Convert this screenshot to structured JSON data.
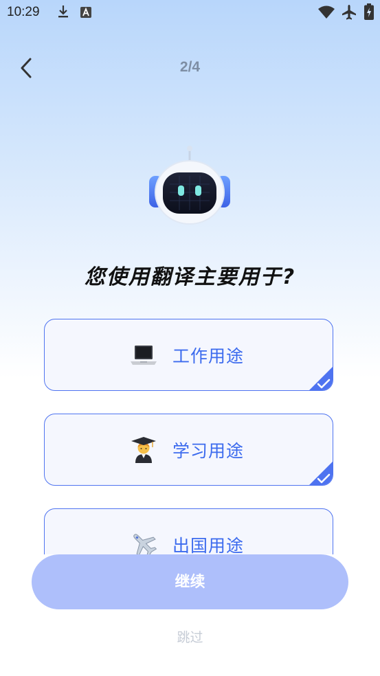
{
  "status_bar": {
    "time": "10:29",
    "left_icons": [
      "download-icon",
      "translate-app-icon"
    ],
    "right_icons": [
      "wifi-icon",
      "airplane-mode-icon",
      "battery-icon"
    ]
  },
  "header": {
    "back_icon": "chevron-left-icon",
    "step": "2/4"
  },
  "mascot": {
    "icon": "robot-mascot-icon"
  },
  "question": "您使用翻译主要用于?",
  "options": [
    {
      "emoji_icon": "laptop-icon",
      "label": "工作用途",
      "selected": true
    },
    {
      "emoji_icon": "graduate-student-icon",
      "label": "学习用途",
      "selected": true
    },
    {
      "emoji_icon": "airplane-icon",
      "label": "出国用途",
      "selected": false
    }
  ],
  "continue_button": {
    "label": "继续"
  },
  "skip_link": {
    "label": "跳过"
  },
  "colors": {
    "accent": "#4e73f0",
    "option_text": "#3c6bee",
    "button_disabled": "#aebffb",
    "step_text": "#7e8ea4",
    "skip_text": "#c6ccd6"
  }
}
